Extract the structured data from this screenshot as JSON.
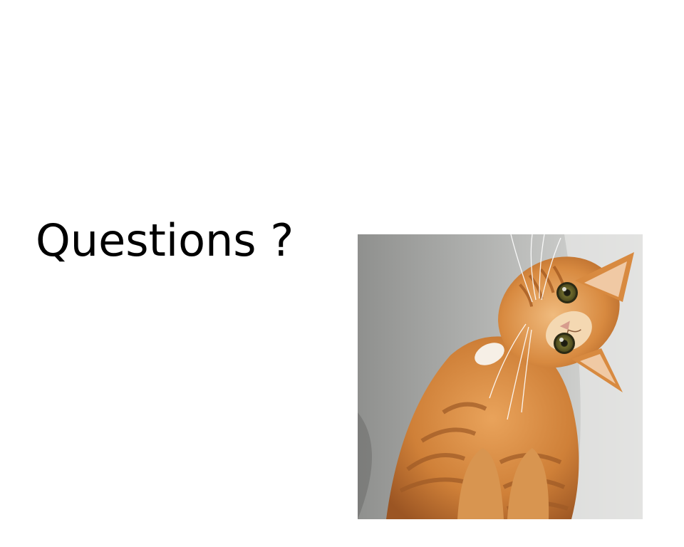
{
  "slide": {
    "title": "Questions ?"
  },
  "image": {
    "subject": "cat-photo"
  },
  "colors": {
    "background": "#ffffff",
    "text": "#000000",
    "wall_light": "#d6d6d4",
    "wall_dark": "#8b8c8a",
    "fur_orange": "#d4883f",
    "fur_dark": "#a65a22",
    "fur_light": "#f2d2a6",
    "eye": "#5d5a26"
  }
}
